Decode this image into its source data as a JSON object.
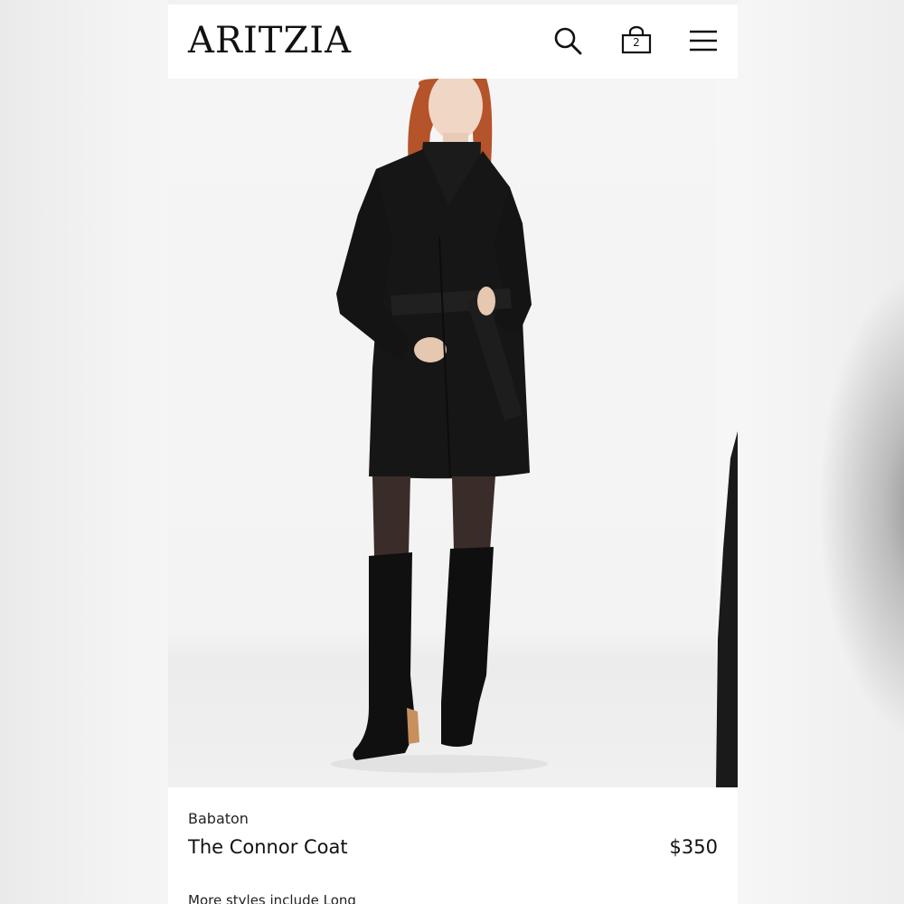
{
  "header": {
    "logo": "ARITZIA",
    "icons": [
      "search-icon",
      "bag-icon",
      "menu-icon"
    ],
    "bag_count": "2"
  },
  "product": {
    "brand": "Babaton",
    "name": "The Connor Coat",
    "price": "$350",
    "more_styles_text": "More styles include Long"
  },
  "colors": {
    "coat": "#161616",
    "hair": "#b5532a",
    "background": "#f4f4f4"
  }
}
